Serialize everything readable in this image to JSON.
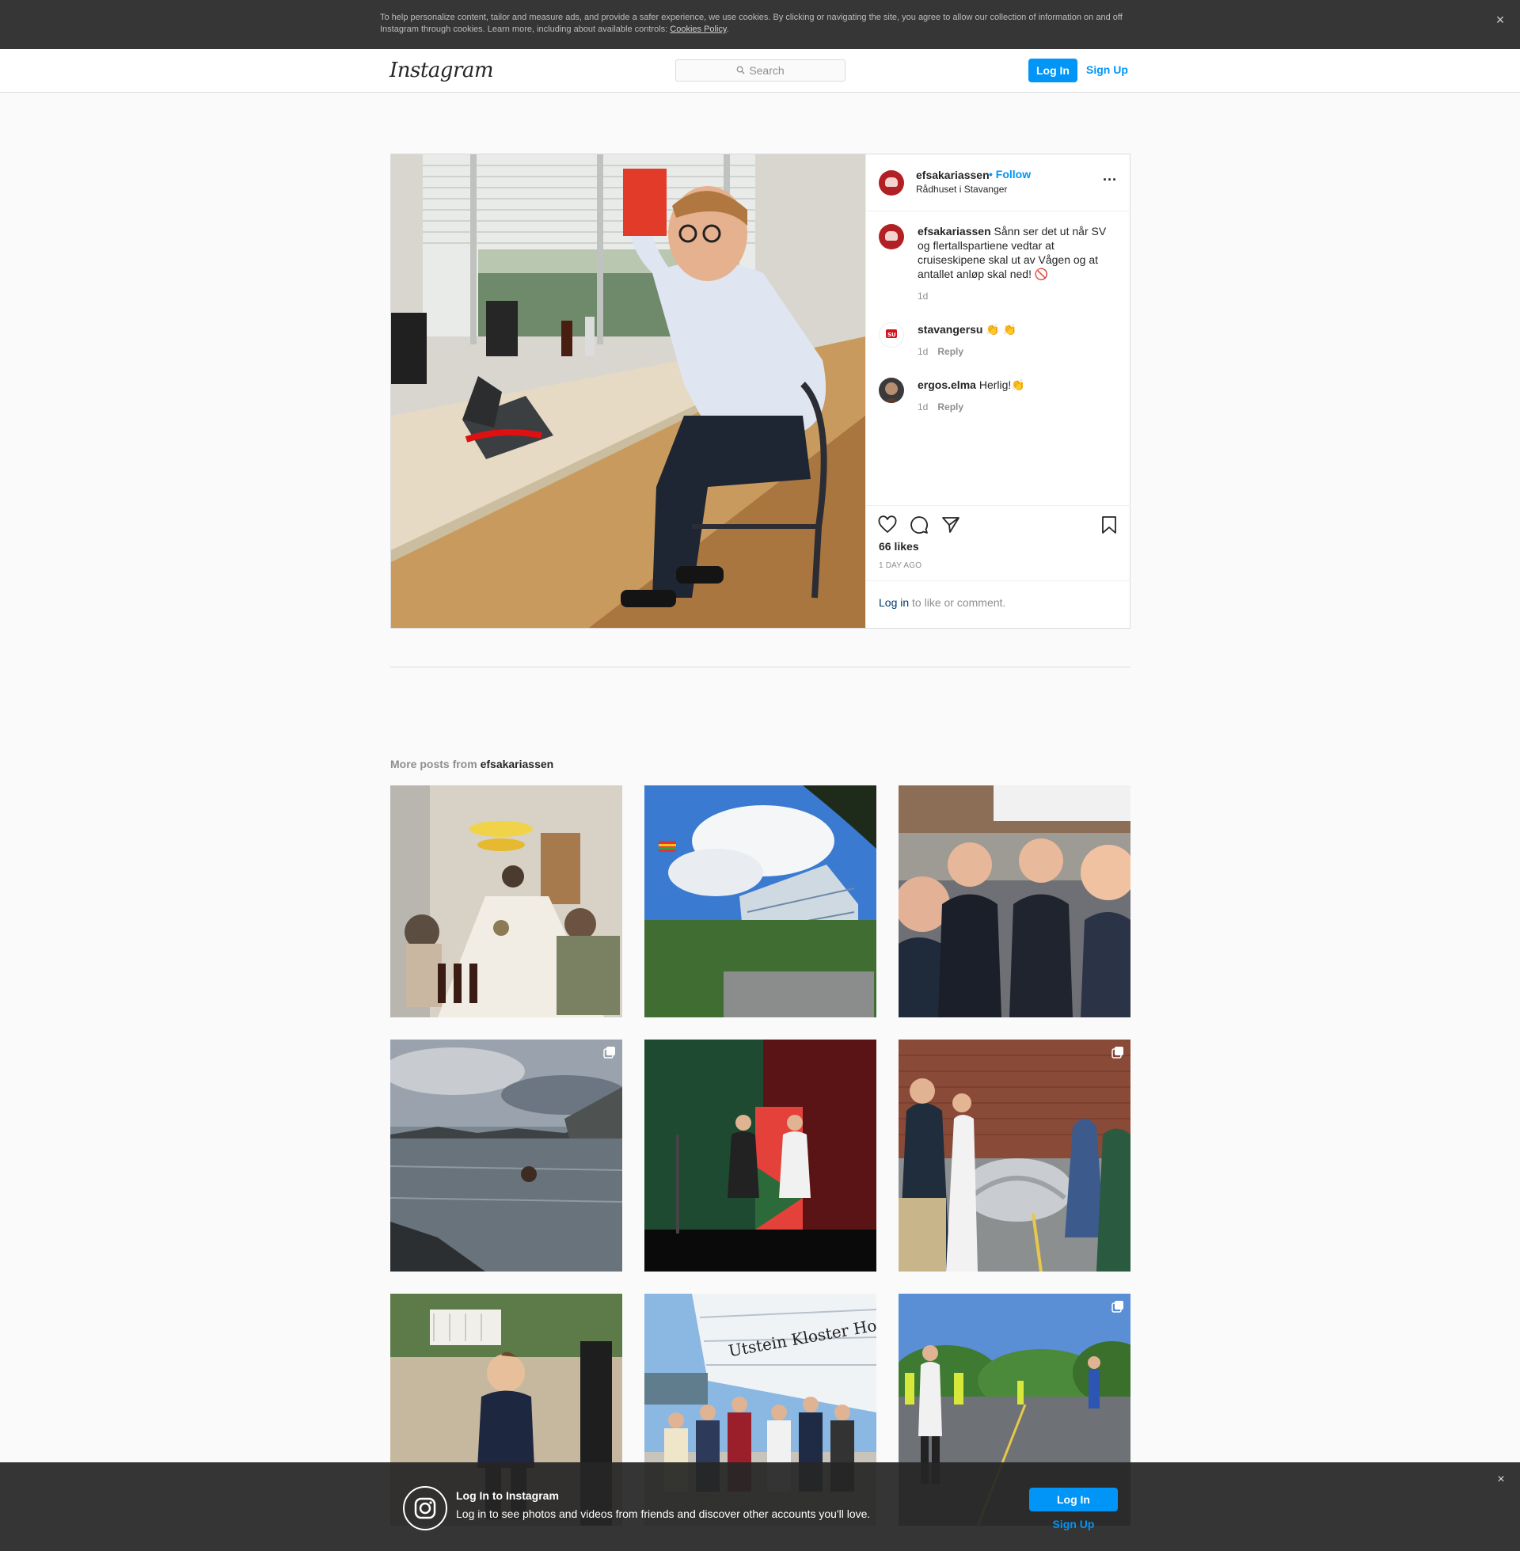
{
  "cookie_banner": {
    "text": "To help personalize content, tailor and measure ads, and provide a safer experience, we use cookies. By clicking or navigating the site, you agree to allow our collection of information on and off Instagram through cookies. Learn more, including about available controls: ",
    "link_label": "Cookies Policy",
    "trailing": ".",
    "close_glyph": "×"
  },
  "header": {
    "logo": "Instagram",
    "search_placeholder": "Search",
    "login_label": "Log In",
    "signup_label": "Sign Up"
  },
  "post": {
    "username": "efsakariassen",
    "follow_label": "• Follow",
    "location": "Rådhuset i Stavanger",
    "more_glyph": "···",
    "caption": {
      "username": "efsakariassen",
      "text": "Sånn ser det ut når SV og flertallspartiene vedtar at cruiseskipene skal ut av Vågen og at antallet anløp skal ned! 🚫",
      "age": "1d"
    },
    "comments": [
      {
        "username": "stavangersu",
        "text": "👏 👏",
        "age": "1d",
        "reply_label": "Reply"
      },
      {
        "username": "ergos.elma",
        "text": "Herlig!👏",
        "age": "1d",
        "reply_label": "Reply"
      }
    ],
    "likes": "66 likes",
    "time_ago": "1 DAY AGO",
    "login_link": "Log in",
    "login_suffix": " to like or comment."
  },
  "more_posts": {
    "prefix": "More posts from ",
    "username": "efsakariassen"
  },
  "bottom_bar": {
    "title": "Log In to Instagram",
    "subtitle": "Log in to see photos and videos from friends and discover other accounts you'll love.",
    "login_label": "Log In",
    "signup_label": "Sign Up",
    "close_glyph": "×"
  },
  "colors": {
    "accent": "#0095f6",
    "link_dark": "#00376b",
    "muted": "#8e8e8e",
    "border": "#dbdbdb"
  }
}
